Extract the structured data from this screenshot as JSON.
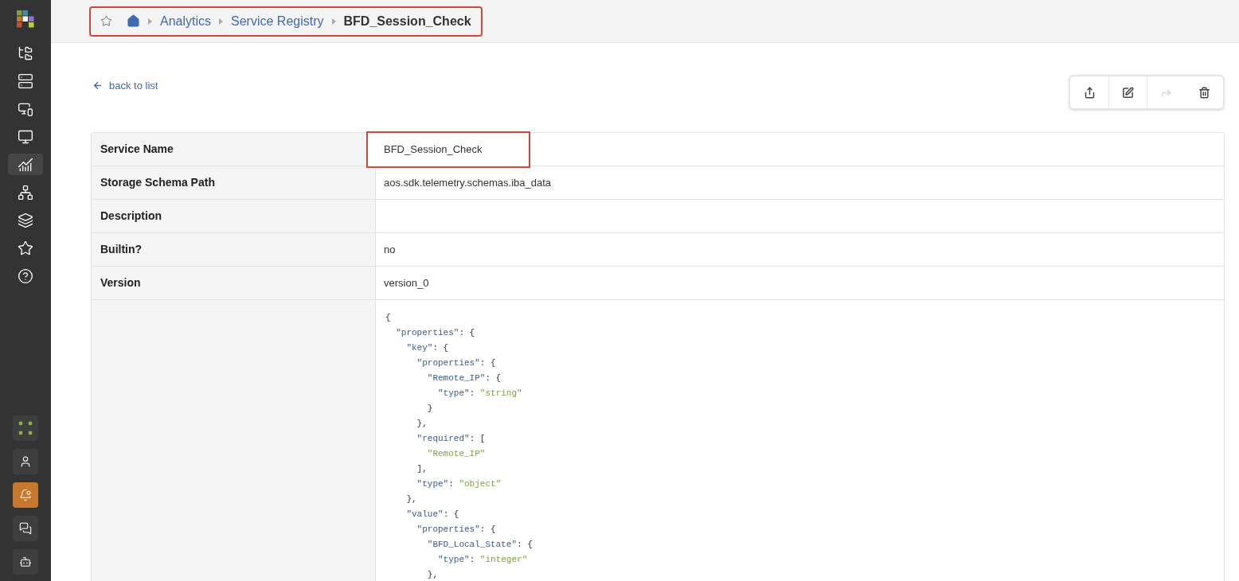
{
  "sidebar": {
    "items": [
      {
        "selected": false
      },
      {
        "selected": false
      },
      {
        "selected": false
      },
      {
        "selected": false
      },
      {
        "selected": true
      },
      {
        "selected": false
      },
      {
        "selected": false
      },
      {
        "selected": false
      },
      {
        "selected": false
      }
    ],
    "bottom_items": [
      {
        "alert": false
      },
      {
        "alert": false
      },
      {
        "alert": true
      },
      {
        "alert": false
      },
      {
        "alert": false
      }
    ]
  },
  "breadcrumb": {
    "highlighted": true,
    "items": [
      {
        "text": "Analytics",
        "kind": "link"
      },
      {
        "text": "Service Registry",
        "kind": "link"
      },
      {
        "text": "BFD_Session_Check",
        "kind": "current"
      }
    ]
  },
  "back_link": "back to list",
  "toolbar": [
    {
      "disabled": false
    },
    {
      "disabled": false
    },
    {
      "disabled": true
    },
    {
      "disabled": false
    }
  ],
  "details": {
    "rows": [
      {
        "label": "Service Name",
        "value": "BFD_Session_Check",
        "highlighted": true
      },
      {
        "label": "Storage Schema Path",
        "value": "aos.sdk.telemetry.schemas.iba_data",
        "highlighted": false
      },
      {
        "label": "Description",
        "highlighted": false
      },
      {
        "label": "Builtin?",
        "value": "no",
        "highlighted": false
      },
      {
        "label": "Version",
        "value": "version_0",
        "highlighted": false
      }
    ],
    "schema_lines": [
      [
        {
          "kind": "punct",
          "text": "{"
        }
      ],
      [
        {
          "kind": "key",
          "text": "  \"properties\""
        },
        {
          "kind": "punct",
          "text": ": {"
        }
      ],
      [
        {
          "kind": "key",
          "text": "    \"key\""
        },
        {
          "kind": "punct",
          "text": ": {"
        }
      ],
      [
        {
          "kind": "key",
          "text": "      \"properties\""
        },
        {
          "kind": "punct",
          "text": ": {"
        }
      ],
      [
        {
          "kind": "key",
          "text": "        \"Remote_IP\""
        },
        {
          "kind": "punct",
          "text": ": {"
        }
      ],
      [
        {
          "kind": "key",
          "text": "          \"type\""
        },
        {
          "kind": "punct",
          "text": ": "
        },
        {
          "kind": "string",
          "text": "\"string\""
        }
      ],
      [
        {
          "kind": "punct",
          "text": "        }"
        }
      ],
      [
        {
          "kind": "punct",
          "text": "      },"
        }
      ],
      [
        {
          "kind": "key",
          "text": "      \"required\""
        },
        {
          "kind": "punct",
          "text": ": ["
        }
      ],
      [
        {
          "kind": "string",
          "text": "        \"Remote_IP\""
        }
      ],
      [
        {
          "kind": "punct",
          "text": "      ],"
        }
      ],
      [
        {
          "kind": "key",
          "text": "      \"type\""
        },
        {
          "kind": "punct",
          "text": ": "
        },
        {
          "kind": "string",
          "text": "\"object\""
        }
      ],
      [
        {
          "kind": "punct",
          "text": "    },"
        }
      ],
      [
        {
          "kind": "key",
          "text": "    \"value\""
        },
        {
          "kind": "punct",
          "text": ": {"
        }
      ],
      [
        {
          "kind": "key",
          "text": "      \"properties\""
        },
        {
          "kind": "punct",
          "text": ": {"
        }
      ],
      [
        {
          "kind": "key",
          "text": "        \"BFD_Local_State\""
        },
        {
          "kind": "punct",
          "text": ": {"
        }
      ],
      [
        {
          "kind": "key",
          "text": "          \"type\""
        },
        {
          "kind": "punct",
          "text": ": "
        },
        {
          "kind": "string",
          "text": "\"integer\""
        }
      ],
      [
        {
          "kind": "punct",
          "text": "        },"
        }
      ]
    ]
  }
}
